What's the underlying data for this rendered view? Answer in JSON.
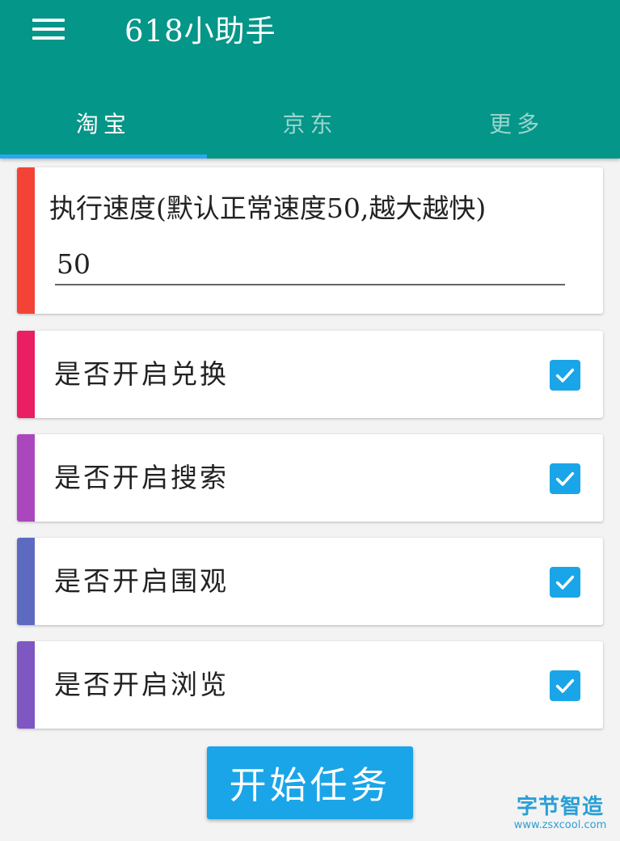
{
  "appbar": {
    "title": "618小助手",
    "color": "#049688"
  },
  "tabs": [
    {
      "label": "淘宝",
      "active": true
    },
    {
      "label": "京东",
      "active": false
    },
    {
      "label": "更多",
      "active": false
    }
  ],
  "speed": {
    "label": "执行速度(默认正常速度50,越大越快)",
    "value": "50",
    "stripe_color": "#f44336"
  },
  "options": [
    {
      "label": "是否开启兑换",
      "checked": true,
      "stripe_color": "#e91e63"
    },
    {
      "label": "是否开启搜索",
      "checked": true,
      "stripe_color": "#ab47bc"
    },
    {
      "label": "是否开启围观",
      "checked": true,
      "stripe_color": "#5c6bc0"
    },
    {
      "label": "是否开启浏览",
      "checked": true,
      "stripe_color": "#7e57c2"
    }
  ],
  "start_button": {
    "label": "开始任务",
    "color": "#1aa5e8"
  },
  "watermark": {
    "text": "字节智造",
    "url": "www.zsxcool.com"
  },
  "icons": {
    "menu": "hamburger-menu-icon",
    "check": "checkmark-icon"
  }
}
